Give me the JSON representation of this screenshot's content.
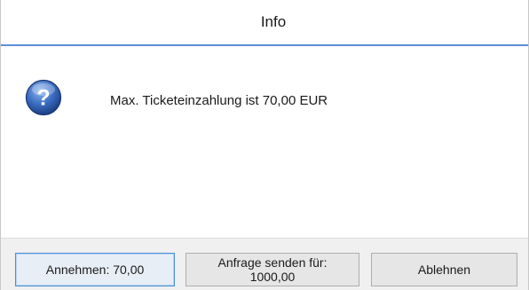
{
  "window": {
    "title": "Info"
  },
  "message": {
    "icon": "question-icon",
    "text": "Max. Ticketeinzahlung ist 70,00 EUR"
  },
  "buttons": {
    "accept_label": "Annehmen: 70,00",
    "request_label": "Anfrage senden für:\n1000,00",
    "decline_label": "Ablehnen"
  },
  "colors": {
    "title_separator": "#5a8ed8",
    "default_button_border": "#4a90d9",
    "icon_blue": "#2f5fb0"
  }
}
